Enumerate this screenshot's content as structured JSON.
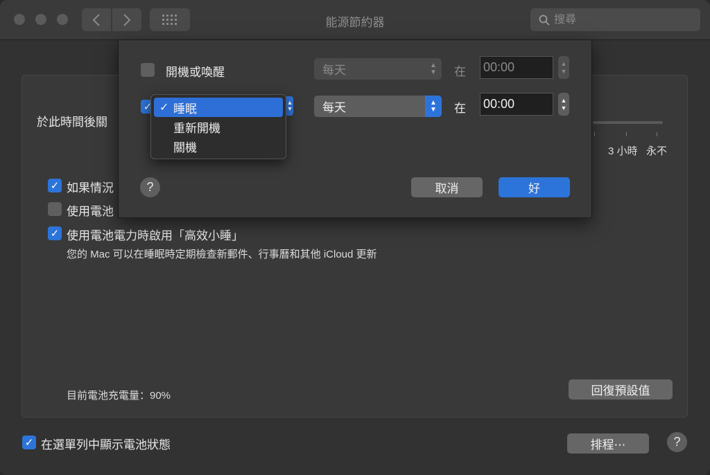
{
  "window": {
    "title": "能源節約器"
  },
  "search": {
    "placeholder": "搜尋"
  },
  "main": {
    "sleep_label": "於此時間後關",
    "slider_ticks": [
      "3 小時",
      "永不"
    ],
    "options": [
      {
        "label": "如果情況",
        "checked": true
      },
      {
        "label": "使用電池",
        "checked": false
      },
      {
        "label": "使用電池電力時啟用「高效小睡」",
        "checked": true
      }
    ],
    "powernap_desc": "您的 Mac 可以在睡眠時定期檢查新郵件、行事曆和其他 iCloud 更新",
    "battery_level": "目前電池充電量：90%",
    "restore_defaults": "回復預設值",
    "show_battery_status": {
      "label": "在選單列中顯示電池狀態",
      "checked": true
    },
    "schedule_button": "排程⋯",
    "help": "?"
  },
  "schedule_sheet": {
    "row1": {
      "label": "開機或喚醒",
      "checked": false,
      "frequency": "每天",
      "at": "在",
      "time": "00:00"
    },
    "row2": {
      "checked": true,
      "action": "睡眠",
      "frequency": "每天",
      "at": "在",
      "time": "00:00"
    },
    "menu_items": [
      "睡眠",
      "重新開機",
      "關機"
    ],
    "help": "?",
    "cancel": "取消",
    "ok": "好"
  },
  "colors": {
    "accent": "#2d74da",
    "window_bg": "#323232",
    "panel_bg": "#393939"
  }
}
